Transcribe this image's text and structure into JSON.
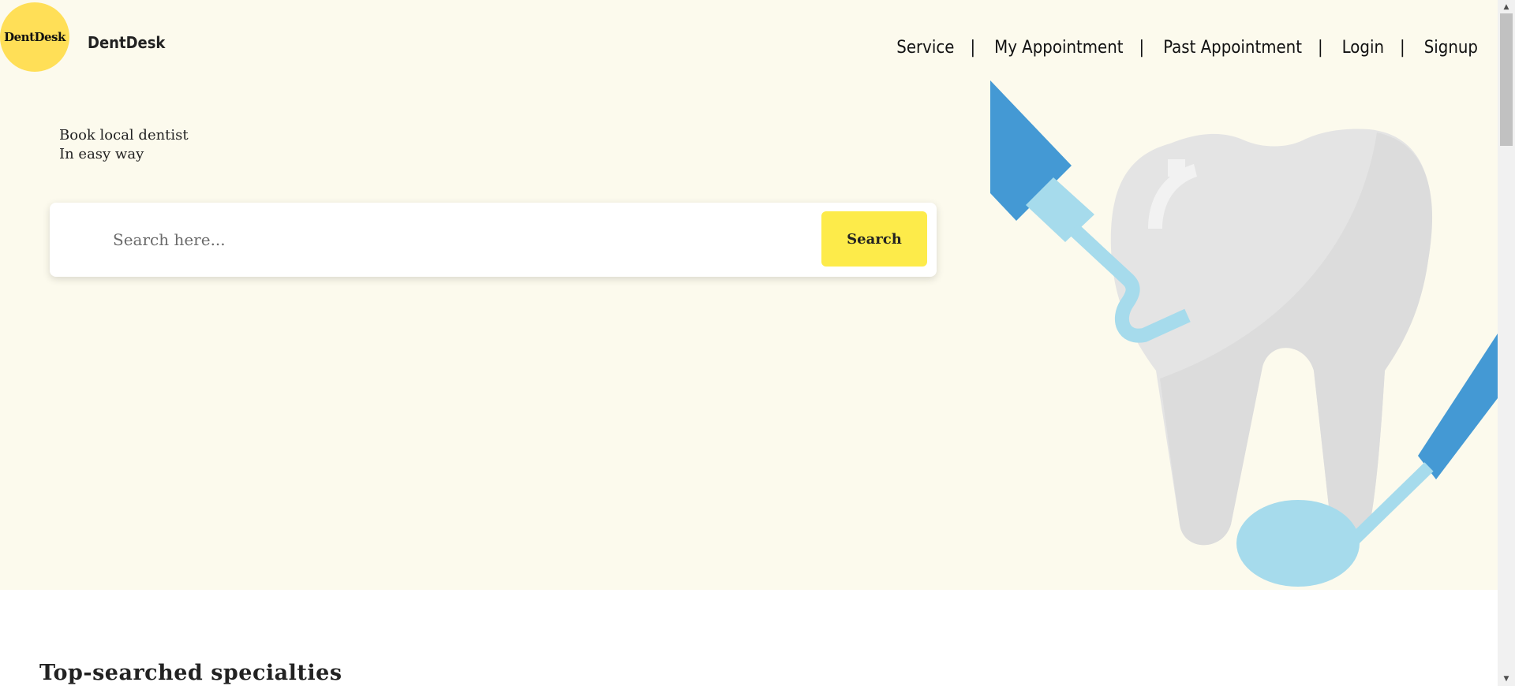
{
  "brand": {
    "logo_text": "DentDesk",
    "name": "DentDesk"
  },
  "nav": {
    "items": [
      {
        "label": "Service"
      },
      {
        "label": "My Appointment"
      },
      {
        "label": "Past Appointment"
      },
      {
        "label": "Login"
      },
      {
        "label": "Signup"
      }
    ],
    "separator": "|"
  },
  "hero": {
    "tagline_line1": "Book local dentist",
    "tagline_line2": "In easy way",
    "illustration_icon": "tooth-with-dental-tools-illustration"
  },
  "search": {
    "placeholder": "Search here...",
    "value": "",
    "button_label": "Search"
  },
  "section": {
    "title": "Top-searched specialties"
  },
  "colors": {
    "hero_background": "#fcfaed",
    "logo_circle": "#ffdf57",
    "search_button": "#fdeb4a",
    "tooth": "#e4e4e4",
    "tool_dark": "#4499d4",
    "tool_light": "#a6dbec"
  },
  "icons": {
    "scroll_up": "▲",
    "scroll_down": "▼"
  }
}
